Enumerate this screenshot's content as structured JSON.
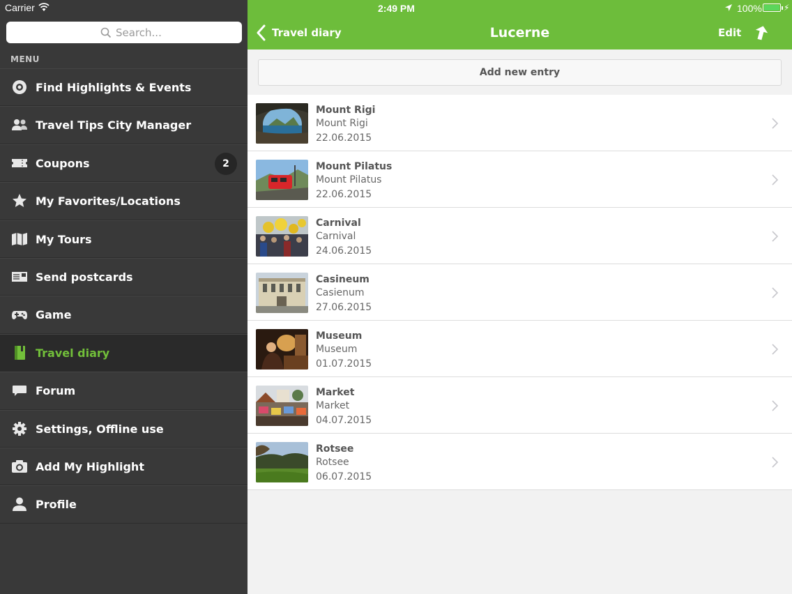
{
  "status_bar": {
    "carrier": "Carrier",
    "time": "2:49 PM",
    "battery": "100%"
  },
  "sidebar": {
    "search_placeholder": "Search...",
    "menu_label": "MENU",
    "items": [
      {
        "label": "Find Highlights & Events",
        "icon": "target-icon"
      },
      {
        "label": "Travel Tips City Manager",
        "icon": "users-icon"
      },
      {
        "label": "Coupons",
        "icon": "ticket-icon",
        "badge": "2"
      },
      {
        "label": "My Favorites/Locations",
        "icon": "star-icon"
      },
      {
        "label": "My Tours",
        "icon": "map-icon"
      },
      {
        "label": "Send postcards",
        "icon": "postcard-icon"
      },
      {
        "label": "Game",
        "icon": "gamepad-icon"
      },
      {
        "label": "Travel diary",
        "icon": "diary-icon",
        "active": true
      },
      {
        "label": "Forum",
        "icon": "chat-icon"
      },
      {
        "label": "Settings, Offline use",
        "icon": "gear-icon"
      },
      {
        "label": "Add My Highlight",
        "icon": "camera-icon"
      },
      {
        "label": "Profile",
        "icon": "person-icon"
      }
    ]
  },
  "navbar": {
    "back_label": "Travel diary",
    "title": "Lucerne",
    "edit_label": "Edit"
  },
  "add_entry_label": "Add new entry",
  "entries": [
    {
      "title": "Mount Rigi",
      "subtitle": "Mount Rigi",
      "date": "22.06.2015"
    },
    {
      "title": "Mount Pilatus",
      "subtitle": "Mount Pilatus",
      "date": "22.06.2015"
    },
    {
      "title": "Carnival",
      "subtitle": "Carnival",
      "date": "24.06.2015"
    },
    {
      "title": "Casineum",
      "subtitle": "Casienum",
      "date": "27.06.2015"
    },
    {
      "title": "Museum",
      "subtitle": "Museum",
      "date": "01.07.2015"
    },
    {
      "title": "Market",
      "subtitle": "Market",
      "date": "04.07.2015"
    },
    {
      "title": "Rotsee",
      "subtitle": "Rotsee",
      "date": "06.07.2015"
    }
  ],
  "colors": {
    "accent": "#6dbd3b",
    "sidebar_bg": "#393939",
    "active_label": "#72bf3a"
  }
}
